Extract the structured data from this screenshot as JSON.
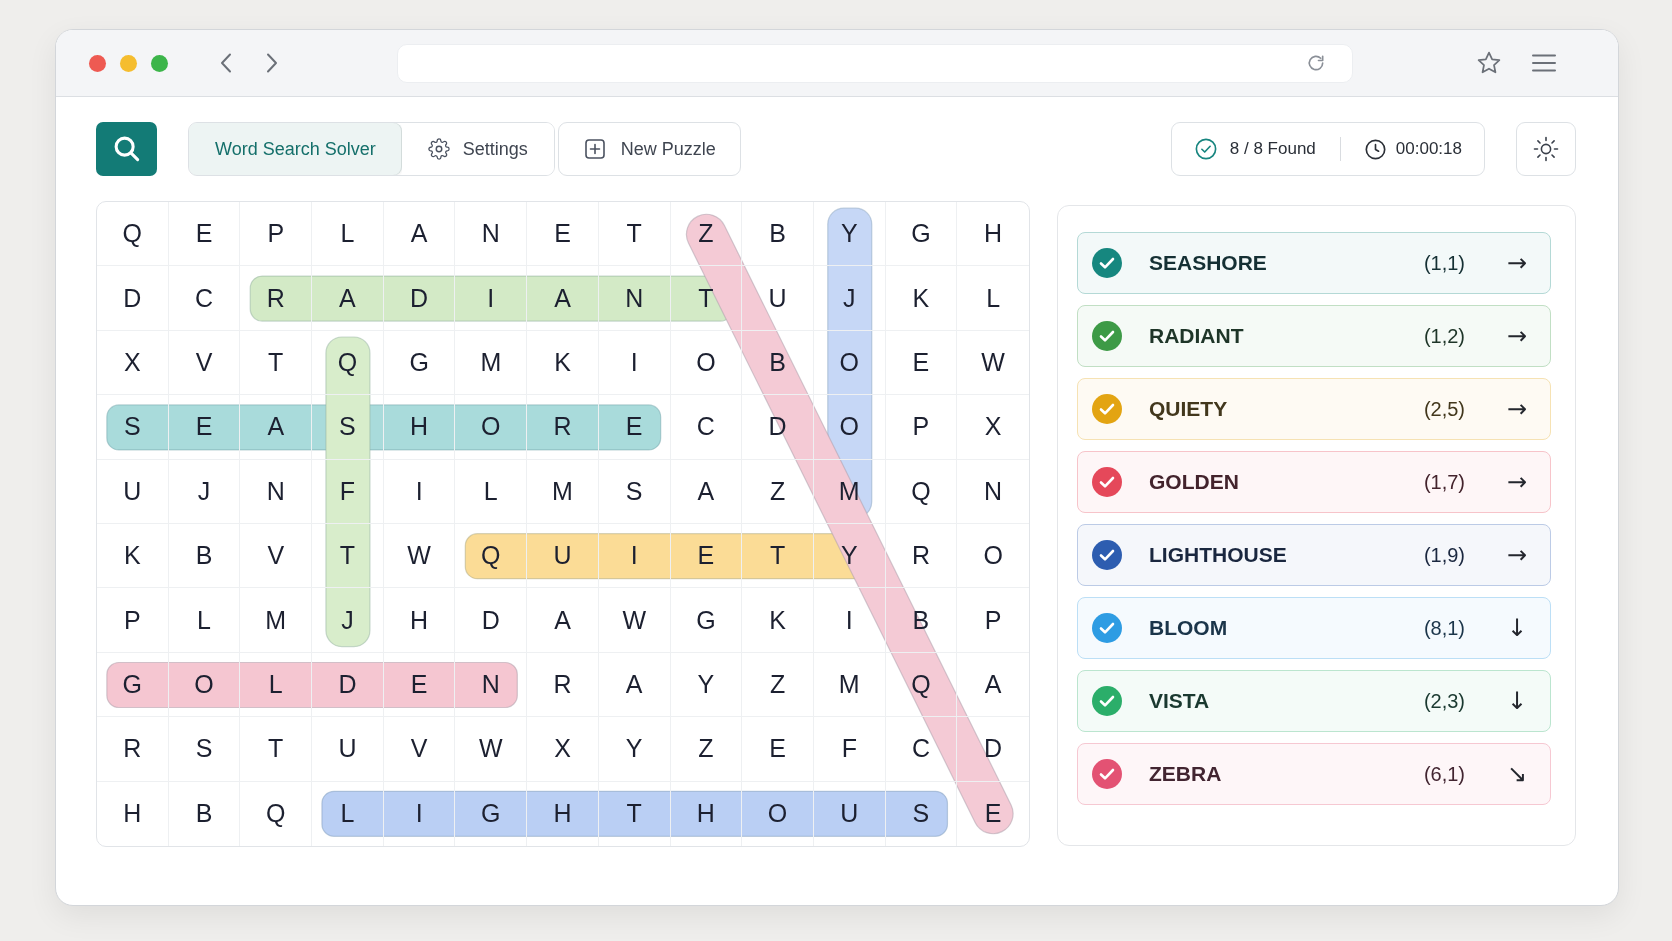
{
  "toolbar": {
    "tabs": [
      {
        "label": "Word Search Solver",
        "selected": true
      },
      {
        "label": "Settings",
        "selected": false
      }
    ],
    "new_puzzle_button": {
      "label": "New Puzzle"
    },
    "status": {
      "found": "8 / 8 Found",
      "timer": "00:00:18"
    }
  },
  "grid": {
    "rows": [
      [
        {
          "letter": "Q"
        },
        {
          "letter": "E"
        },
        {
          "letter": "P"
        },
        {
          "letter": "L"
        },
        {
          "letter": "A"
        },
        {
          "letter": "N"
        },
        {
          "letter": "E"
        },
        {
          "letter": "T"
        },
        {
          "letter": "Z",
          "highlight_start": {
            "color": "#f4cad5"
          }
        },
        {
          "letter": "B"
        },
        {
          "letter": "Y",
          "highlight_start": {
            "color": "#c6d7f6"
          }
        },
        {
          "letter": "G"
        },
        {
          "letter": "H"
        }
      ],
      [
        {
          "letter": "D"
        },
        {
          "letter": "C"
        },
        {
          "letter": "R",
          "highlight_start": {
            "color": "#d3eac6"
          }
        },
        {
          "letter": "A"
        },
        {
          "letter": "D"
        },
        {
          "letter": "I"
        },
        {
          "letter": "A"
        },
        {
          "letter": "N"
        },
        {
          "letter": "T",
          "highlight_end": {
            "color": "#d3eac6"
          }
        },
        {
          "letter": "U"
        },
        {
          "letter": "J"
        },
        {
          "letter": "K"
        },
        {
          "letter": "L"
        }
      ],
      [
        {
          "letter": "X"
        },
        {
          "letter": "V"
        },
        {
          "letter": "T"
        },
        {
          "letter": "Q",
          "highlight_start": {
            "color": "#d8edcb"
          }
        },
        {
          "letter": "G"
        },
        {
          "letter": "M"
        },
        {
          "letter": "K"
        },
        {
          "letter": "I"
        },
        {
          "letter": "O"
        },
        {
          "letter": "B"
        },
        {
          "letter": "O"
        },
        {
          "letter": "E"
        },
        {
          "letter": "W"
        }
      ],
      [
        {
          "letter": "S",
          "highlight_start": {
            "color": "#a9dbdb"
          }
        },
        {
          "letter": "E"
        },
        {
          "letter": "A"
        },
        {
          "letter": "S"
        },
        {
          "letter": "H"
        },
        {
          "letter": "O"
        },
        {
          "letter": "R"
        },
        {
          "letter": "E",
          "highlight_end": {
            "color": "#a9dbdb"
          }
        },
        {
          "letter": "C"
        },
        {
          "letter": "D"
        },
        {
          "letter": "O"
        },
        {
          "letter": "P"
        },
        {
          "letter": "X"
        }
      ],
      [
        {
          "letter": "U"
        },
        {
          "letter": "J"
        },
        {
          "letter": "N"
        },
        {
          "letter": "F"
        },
        {
          "letter": "I"
        },
        {
          "letter": "L"
        },
        {
          "letter": "M"
        },
        {
          "letter": "S"
        },
        {
          "letter": "A"
        },
        {
          "letter": "Z"
        },
        {
          "letter": "M",
          "highlight_end": {
            "color": "#c6d7f6"
          }
        },
        {
          "letter": "Q"
        },
        {
          "letter": "N"
        }
      ],
      [
        {
          "letter": "K"
        },
        {
          "letter": "B"
        },
        {
          "letter": "V"
        },
        {
          "letter": "T"
        },
        {
          "letter": "W"
        },
        {
          "letter": "Q",
          "highlight_start": {
            "color": "#fbdc96"
          }
        },
        {
          "letter": "U"
        },
        {
          "letter": "I"
        },
        {
          "letter": "E"
        },
        {
          "letter": "T"
        },
        {
          "letter": "Y",
          "highlight_end": {
            "color": "#fbdc96"
          }
        },
        {
          "letter": "R"
        },
        {
          "letter": "O"
        }
      ],
      [
        {
          "letter": "P"
        },
        {
          "letter": "L"
        },
        {
          "letter": "M"
        },
        {
          "letter": "J",
          "highlight_end": {
            "color": "#d8edcb"
          }
        },
        {
          "letter": "H"
        },
        {
          "letter": "D"
        },
        {
          "letter": "A"
        },
        {
          "letter": "W"
        },
        {
          "letter": "G"
        },
        {
          "letter": "K"
        },
        {
          "letter": "I"
        },
        {
          "letter": "B"
        },
        {
          "letter": "P"
        }
      ],
      [
        {
          "letter": "G",
          "highlight_start": {
            "color": "#f5c6d1"
          }
        },
        {
          "letter": "O"
        },
        {
          "letter": "L"
        },
        {
          "letter": "D"
        },
        {
          "letter": "E"
        },
        {
          "letter": "N",
          "highlight_end": {
            "color": "#f5c6d1"
          }
        },
        {
          "letter": "R"
        },
        {
          "letter": "A"
        },
        {
          "letter": "Y"
        },
        {
          "letter": "Z"
        },
        {
          "letter": "M"
        },
        {
          "letter": "Q"
        },
        {
          "letter": "A"
        }
      ],
      [
        {
          "letter": "R"
        },
        {
          "letter": "S"
        },
        {
          "letter": "T"
        },
        {
          "letter": "U"
        },
        {
          "letter": "V"
        },
        {
          "letter": "W"
        },
        {
          "letter": "X"
        },
        {
          "letter": "Y"
        },
        {
          "letter": "Z"
        },
        {
          "letter": "E"
        },
        {
          "letter": "F"
        },
        {
          "letter": "C"
        },
        {
          "letter": "D"
        }
      ],
      [
        {
          "letter": "H"
        },
        {
          "letter": "B"
        },
        {
          "letter": "Q"
        },
        {
          "letter": "L",
          "highlight_start": {
            "color": "#bacff4"
          }
        },
        {
          "letter": "I"
        },
        {
          "letter": "G"
        },
        {
          "letter": "H"
        },
        {
          "letter": "T"
        },
        {
          "letter": "H"
        },
        {
          "letter": "O"
        },
        {
          "letter": "U"
        },
        {
          "letter": "S",
          "highlight_end": {
            "color": "#bacff4"
          }
        },
        {
          "letter": "E",
          "highlight_end": {
            "color": "#f4cad5"
          }
        }
      ]
    ]
  },
  "found_words": [
    {
      "word": "SEASHORE",
      "position": "(1,1)",
      "direction": "→",
      "color": "#16877f"
    },
    {
      "word": "RADIANT",
      "position": "(1,2)",
      "direction": "→",
      "color": "#3d9a46"
    },
    {
      "word": "QUIETY",
      "position": "(2,5)",
      "direction": "→",
      "color": "#e3a412"
    },
    {
      "word": "GOLDEN",
      "position": "(1,7)",
      "direction": "→",
      "color": "#e5485a"
    },
    {
      "word": "LIGHTHOUSE",
      "position": "(1,9)",
      "direction": "→",
      "color": "#2d5db0"
    },
    {
      "word": "BLOOM",
      "position": "(8,1)",
      "direction": "↓",
      "color": "#2e9ce3"
    },
    {
      "word": "VISTA",
      "position": "(2,3)",
      "direction": "↓",
      "color": "#2bae6a"
    },
    {
      "word": "ZEBRA",
      "position": "(6,1)",
      "direction": "↘",
      "color": "#e35273"
    }
  ]
}
